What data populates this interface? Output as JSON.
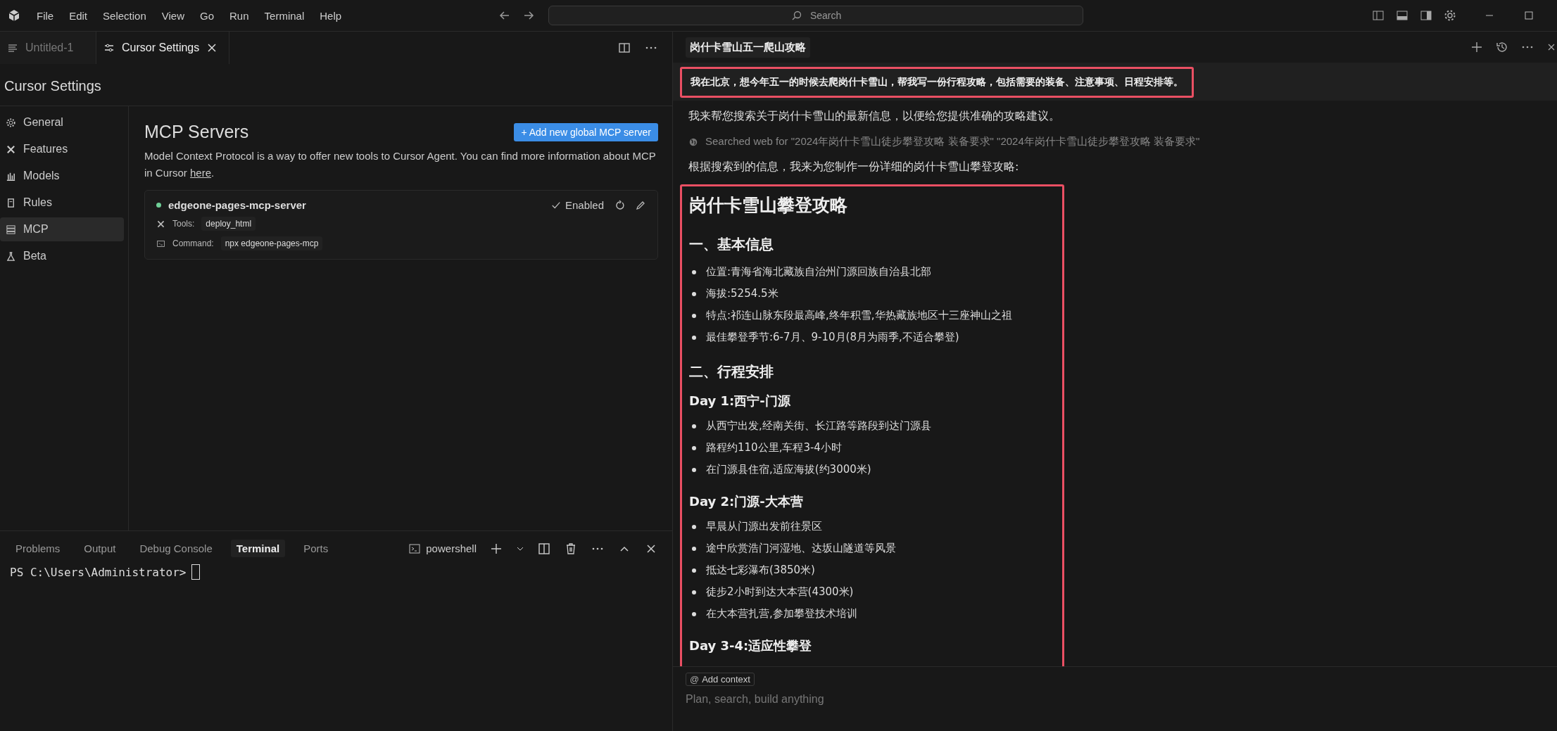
{
  "menu": [
    "File",
    "Edit",
    "Selection",
    "View",
    "Go",
    "Run",
    "Terminal",
    "Help"
  ],
  "search": {
    "placeholder": "Search"
  },
  "editor_tabs": [
    {
      "label": "Untitled-1",
      "selected": false
    },
    {
      "label": "Cursor Settings",
      "selected": true
    }
  ],
  "settings": {
    "title": "Cursor Settings",
    "sidebar": [
      {
        "label": "General",
        "selected": false
      },
      {
        "label": "Features",
        "selected": false
      },
      {
        "label": "Models",
        "selected": false
      },
      {
        "label": "Rules",
        "selected": false
      },
      {
        "label": "MCP",
        "selected": true
      },
      {
        "label": "Beta",
        "selected": false
      }
    ],
    "heading": "MCP Servers",
    "add_button": "+ Add new global MCP server",
    "description": "Model Context Protocol is a way to offer new tools to Cursor Agent. You can find more information about MCP in Cursor ",
    "description_link": "here",
    "description_end": ".",
    "servers": [
      {
        "name": "edgeone-pages-mcp-server",
        "enabled": true,
        "status": "Enabled",
        "tools_label": "Tools:",
        "tools": [
          "deploy_html"
        ],
        "command_label": "Command:",
        "command": "npx edgeone-pages-mcp"
      }
    ]
  },
  "panel": {
    "tabs": [
      {
        "label": "Problems",
        "selected": false
      },
      {
        "label": "Output",
        "selected": false
      },
      {
        "label": "Debug Console",
        "selected": false
      },
      {
        "label": "Terminal",
        "selected": true
      },
      {
        "label": "Ports",
        "selected": false
      }
    ],
    "shell": "powershell",
    "terminal_line": "PS C:\\Users\\Administrator>"
  },
  "chat": {
    "title": "岗什卡雪山五一爬山攻略",
    "messages": [
      {
        "kind": "user",
        "highlighted": true,
        "text": "我在北京，想今年五一的时候去爬岗什卡雪山，帮我写一份行程攻略，包括需要的装备、注意事项、日程安排等。"
      },
      {
        "kind": "text",
        "text": "我来帮您搜索关于岗什卡雪山的最新信息，以便给您提供准确的攻略建议。"
      },
      {
        "kind": "search",
        "text": "Searched web for \"2024年岗什卡雪山徒步攀登攻略 装备要求\" \"2024年岗什卡雪山徒步攀登攻略 装备要求\""
      },
      {
        "kind": "text",
        "text": "根据搜索到的信息，我来为您制作一份详细的岗什卡雪山攀登攻略:"
      },
      {
        "kind": "markdown",
        "highlighted": true,
        "blocks": [
          {
            "kind": "h1",
            "text": "岗什卡雪山攀登攻略"
          },
          {
            "kind": "h2",
            "text": "一、基本信息"
          },
          {
            "kind": "li",
            "text": "位置:青海省海北藏族自治州门源回族自治县北部"
          },
          {
            "kind": "li",
            "text": "海拔:5254.5米"
          },
          {
            "kind": "li",
            "text": "特点:祁连山脉东段最高峰,终年积雪,华热藏族地区十三座神山之祖"
          },
          {
            "kind": "li",
            "text": "最佳攀登季节:6-7月、9-10月(8月为雨季,不适合攀登)"
          },
          {
            "kind": "h2",
            "text": "二、行程安排"
          },
          {
            "kind": "h3",
            "text": "Day 1:西宁-门源"
          },
          {
            "kind": "li",
            "text": "从西宁出发,经南关街、长江路等路段到达门源县"
          },
          {
            "kind": "li",
            "text": "路程约110公里,车程3-4小时"
          },
          {
            "kind": "li",
            "text": "在门源县住宿,适应海拔(约3000米)"
          },
          {
            "kind": "h3",
            "text": "Day 2:门源-大本营"
          },
          {
            "kind": "li",
            "text": "早晨从门源出发前往景区"
          },
          {
            "kind": "li",
            "text": "途中欣赏浩门河湿地、达坂山隧道等风景"
          },
          {
            "kind": "li",
            "text": "抵达七彩瀑布(3850米)"
          },
          {
            "kind": "li",
            "text": "徒步2小时到达大本营(4300米)"
          },
          {
            "kind": "li",
            "text": "在大本营扎营,参加攀登技术培训"
          },
          {
            "kind": "h3",
            "text": "Day 3-4:适应性攀登"
          }
        ]
      }
    ]
  },
  "input": {
    "context_icon": "@",
    "context_label": "Add context",
    "placeholder": "Plan, search, build anything"
  }
}
